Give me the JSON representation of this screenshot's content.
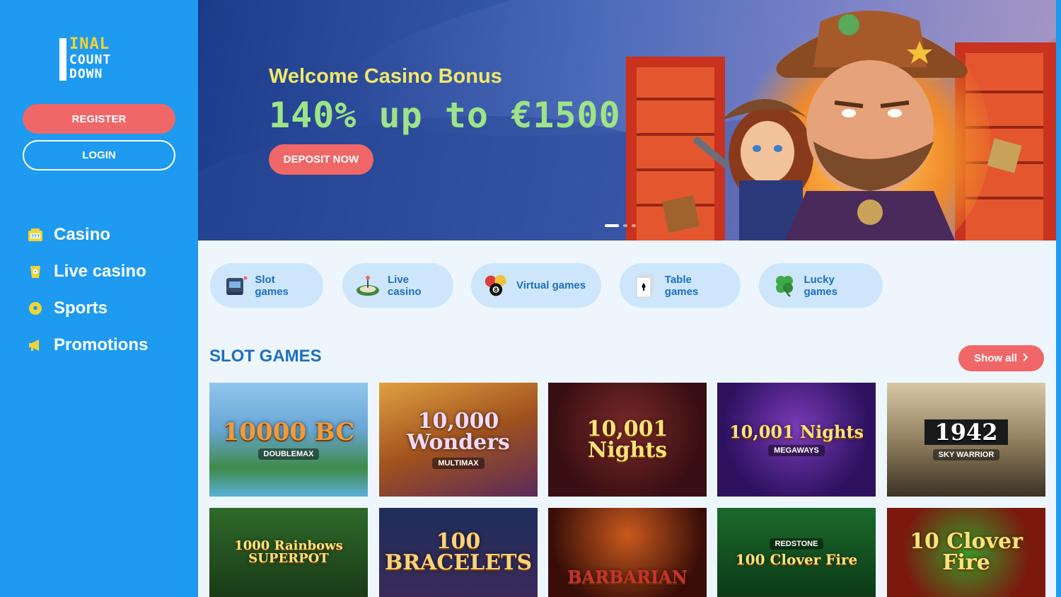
{
  "brand": {
    "logo_line1": [
      "F",
      "INAL"
    ],
    "logo_line2": "COUNT",
    "logo_line3": "DOWN"
  },
  "auth": {
    "register_label": "REGISTER",
    "login_label": "LOGIN"
  },
  "nav": [
    {
      "label": "Casino",
      "icon": "slot-machine-icon"
    },
    {
      "label": "Live casino",
      "icon": "dice-cup-icon"
    },
    {
      "label": "Sports",
      "icon": "soccer-ball-icon"
    },
    {
      "label": "Promotions",
      "icon": "megaphone-icon"
    }
  ],
  "hero": {
    "subtitle": "Welcome Casino Bonus",
    "title": "140% up to €1500",
    "cta_label": "DEPOSIT NOW",
    "slides": 3,
    "active_slide": 1
  },
  "categories": [
    {
      "label": "Slot games",
      "icon": "slot-machine-icon"
    },
    {
      "label": "Live casino",
      "icon": "roulette-icon"
    },
    {
      "label": "Virtual games",
      "icon": "billiard-balls-icon"
    },
    {
      "label": "Table games",
      "icon": "playing-card-icon"
    },
    {
      "label": "Lucky games",
      "icon": "clover-icon"
    }
  ],
  "slot_section": {
    "title": "SLOT GAMES",
    "show_all_label": "Show all",
    "games": [
      {
        "name": "10000 BC",
        "sub": "DOUBLEMAX"
      },
      {
        "name": "10,000 Wonders",
        "sub": "MULTIMAX"
      },
      {
        "name": "10,001 Nights",
        "sub": ""
      },
      {
        "name": "10,001 Nights",
        "sub": "MEGAWAYS"
      },
      {
        "name": "1942",
        "sub": "SKY WARRIOR"
      },
      {
        "name": "1000 Rainbows SUPERPOT",
        "sub": ""
      },
      {
        "name": "100 BRACELETS",
        "sub": ""
      },
      {
        "name": "BARBARIAN",
        "sub": ""
      },
      {
        "name": "100 Clover Fire",
        "sub": "REDSTONE"
      },
      {
        "name": "10 Clover Fire",
        "sub": ""
      }
    ]
  },
  "colors": {
    "sidebar": "#1e9af0",
    "accent": "#f06767",
    "pill_bg": "#cde6fb",
    "text_blue": "#1d6fbf",
    "hero_yellow": "#f2e86a",
    "hero_green": "#9ee486"
  }
}
